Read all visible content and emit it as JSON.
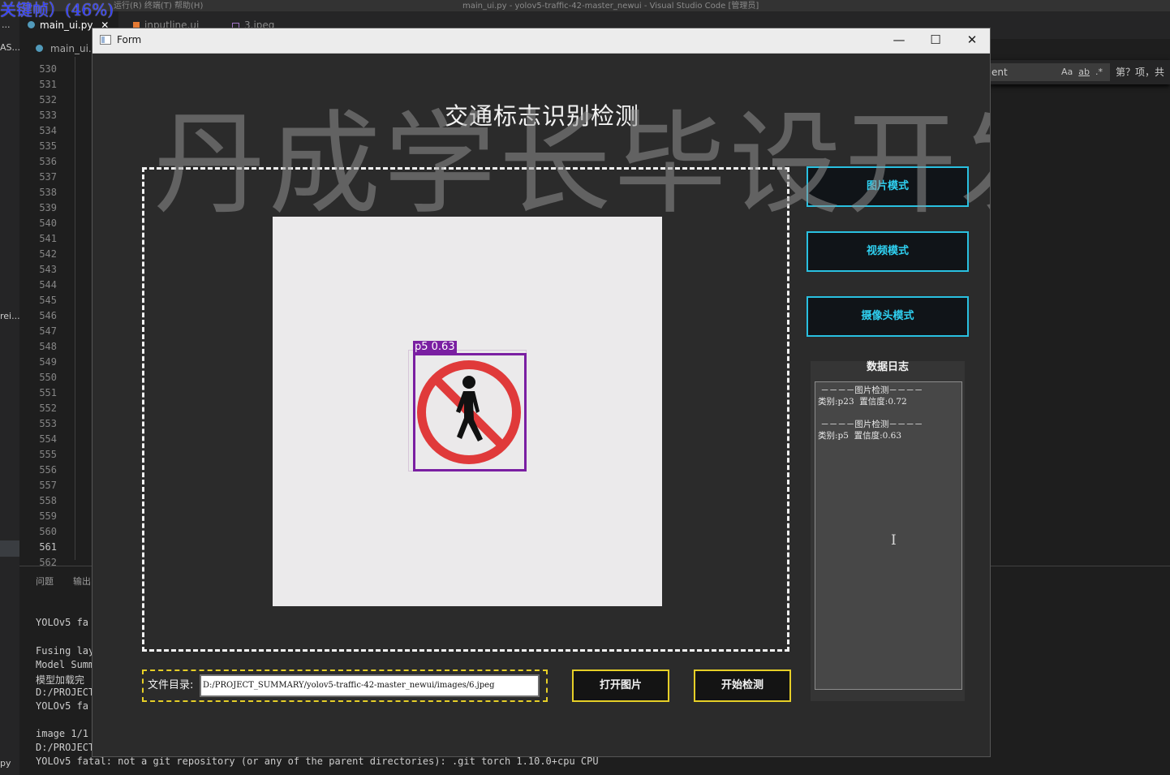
{
  "vscode": {
    "recorder_overlay": "关键帧）(46%)",
    "window_title": "main_ui.py - yolov5-traffic-42-master_newui - Visual Studio Code [管理员]",
    "menu_fragment": "运行(R)    终端(T)    帮助(H)",
    "activity_labels": [
      "...",
      "AS...",
      "rei...",
      "py"
    ],
    "tabs": [
      {
        "label": "main_ui.py",
        "close": "✕",
        "active": true
      },
      {
        "label": "inputline.ui",
        "active": false
      },
      {
        "label": "3.jpeg",
        "active": false
      }
    ],
    "breadcrumb": "main_ui.py",
    "line_numbers": [
      "530",
      "531",
      "532",
      "533",
      "534",
      "535",
      "536",
      "537",
      "538",
      "539",
      "540",
      "541",
      "542",
      "543",
      "544",
      "545",
      "546",
      "547",
      "548",
      "549",
      "550",
      "551",
      "552",
      "553",
      "554",
      "555",
      "556",
      "557",
      "558",
      "559",
      "560",
      "561",
      "562"
    ],
    "current_line": "561",
    "find": {
      "query": "ent",
      "match_case": "Aa",
      "whole_word": "ab",
      "regex": ".*",
      "count": "第？项，共"
    },
    "panel_tabs": [
      "问题",
      "输出"
    ],
    "terminal_lines": [
      "YOLOv5  fa",
      "Fusing lay",
      "Model Summ",
      "模型加载完",
      "D:/PROJECT",
      "YOLOv5  fa",
      "image 1/1",
      "D:/PROJECT",
      "YOLOv5  fatal: not a git repository (or any of the parent directories): .git torch 1.10.0+cpu CPU"
    ]
  },
  "form": {
    "window_title": "Form",
    "controls": {
      "minimize": "—",
      "maximize": "☐",
      "close": "✕"
    },
    "main_title": "交通标志识别检测",
    "watermark": "丹成学长毕设开发",
    "detection": {
      "label": "p5 0.63",
      "box_color": "#7a1fa2",
      "sign": "no-pedestrians-icon"
    },
    "mode_buttons": {
      "image": "图片模式",
      "video": "视频模式",
      "camera": "摄像头模式"
    },
    "path_label": "文件目录:",
    "path_value": "D:/PROJECT_SUMMARY/yolov5-traffic-42-master_newui/images/6.jpeg",
    "open_button": "打开图片",
    "detect_button": "开始检测",
    "log": {
      "title": "数据日志",
      "entries": [
        {
          "header": " －－－－图片检测－－－－",
          "detail": "类别:p23  置信度:0.72"
        },
        {
          "header": " －－－－图片检测－－－－",
          "detail": "类别:p5  置信度:0.63"
        }
      ]
    },
    "colors": {
      "mode_button_border": "#29c0e0",
      "action_button_border": "#e6cf27",
      "background": "#2b2b2b"
    }
  }
}
